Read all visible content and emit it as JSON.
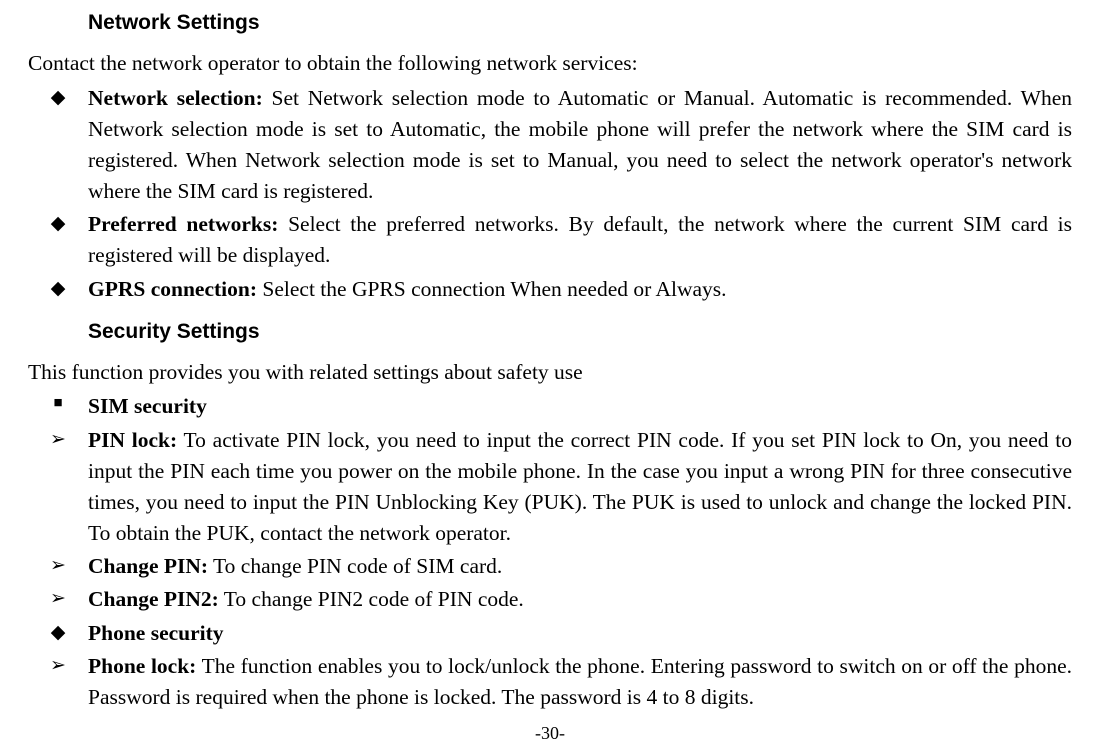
{
  "headings": {
    "network": "Network Settings",
    "security": "Security Settings"
  },
  "intros": {
    "network": "Contact the network operator to obtain the following network services:",
    "security": "This function provides you with related settings about safety use"
  },
  "bullets": {
    "diamond": "◆",
    "arrow": "➢",
    "square": "■"
  },
  "network_items": [
    {
      "title": "Network selection:",
      "text": " Set Network selection mode to Automatic or Manual. Automatic is recommended. When Network selection mode is set to Automatic, the mobile phone will prefer the network where the SIM card is registered. When Network selection mode is set to Manual, you need to select the network operator's network where the SIM card is registered."
    },
    {
      "title": "Preferred networks:",
      "text": " Select the preferred networks. By default, the network where the current SIM card is registered will be displayed."
    },
    {
      "title": "GPRS connection:",
      "text": " Select the GPRS connection When needed or Always."
    }
  ],
  "security_items": [
    {
      "bullet": "square",
      "title": "SIM security",
      "text": ""
    },
    {
      "bullet": "arrow",
      "title": "PIN lock:",
      "text": " To activate PIN lock, you need to input the correct PIN code. If you set PIN lock to On, you need to input the PIN each time you power on the mobile phone. In the case you input a wrong PIN for three consecutive times, you need to input the PIN Unblocking Key (PUK). The PUK is used to unlock and change the locked PIN. To obtain the PUK, contact the network operator."
    },
    {
      "bullet": "arrow",
      "title": "Change PIN:",
      "text": " To change PIN code of SIM card."
    },
    {
      "bullet": "arrow",
      "title": "Change PIN2:",
      "text": " To change PIN2 code of PIN code."
    },
    {
      "bullet": "diamond",
      "title": "Phone security",
      "text": ""
    },
    {
      "bullet": "arrow",
      "title": "Phone lock:",
      "text": " The function enables you to lock/unlock the phone. Entering password to switch on or off the phone. Password is required when the phone is locked. The password is 4 to 8 digits."
    }
  ],
  "page_number": "-30-"
}
